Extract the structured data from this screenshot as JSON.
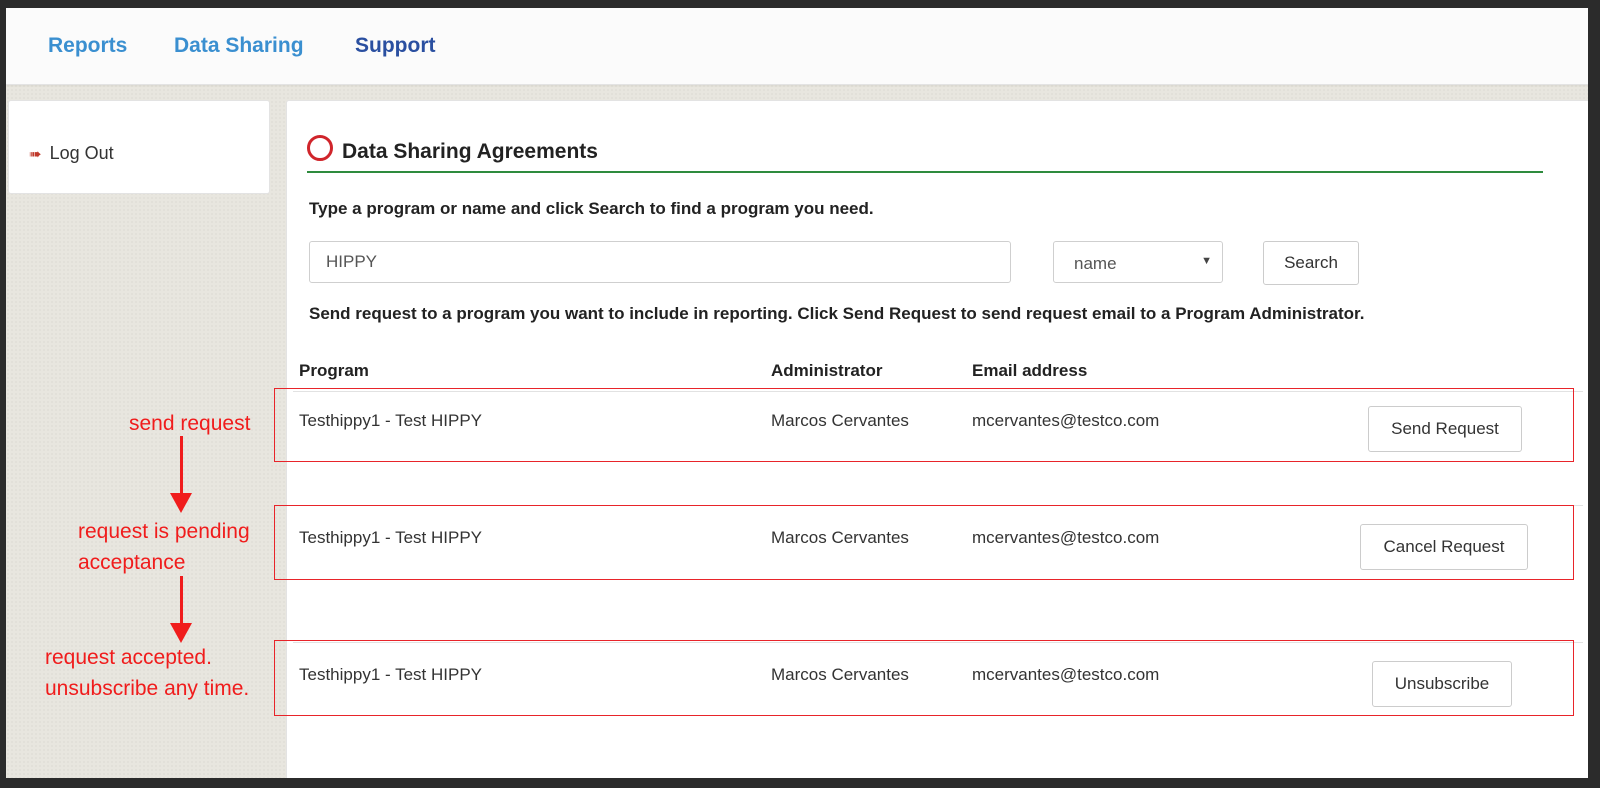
{
  "nav": {
    "items": [
      {
        "label": "Reports"
      },
      {
        "label": "Data Sharing"
      },
      {
        "label": "Support"
      }
    ]
  },
  "sidebar": {
    "logout_label": "Log Out",
    "logout_icon": "sign-out-icon"
  },
  "main": {
    "title": "Data Sharing Agreements",
    "title_icon": "circle-icon",
    "instruction_search": "Type a program or name and click Search to find a program you need.",
    "search": {
      "value": "HIPPY",
      "filter_selected": "name",
      "button_label": "Search"
    },
    "instruction_request": "Send request to a program you want to include in reporting. Click Send Request to send request email to a Program Administrator.",
    "table": {
      "columns": [
        "Program",
        "Administrator",
        "Email address"
      ],
      "rows": [
        {
          "program": "Testhippy1 - Test HIPPY",
          "administrator": "Marcos Cervantes",
          "email": "mcervantes@testco.com",
          "action": "Send Request"
        },
        {
          "program": "Testhippy1 - Test HIPPY",
          "administrator": "Marcos Cervantes",
          "email": "mcervantes@testco.com",
          "action": "Cancel Request"
        },
        {
          "program": "Testhippy1 - Test HIPPY",
          "administrator": "Marcos Cervantes",
          "email": "mcervantes@testco.com",
          "action": "Unsubscribe"
        }
      ]
    }
  },
  "annotations": {
    "step1": "send request",
    "step2_line1": "request is pending",
    "step2_line2": "acceptance",
    "step3_line1": "request accepted.",
    "step3_line2": "unsubscribe any time."
  },
  "colors": {
    "nav_link": "#3a8fd0",
    "nav_active": "#2a4fa0",
    "heading_rule": "#2e8b3e",
    "title_icon": "#d0252b",
    "annotation": "#f01c1c"
  }
}
